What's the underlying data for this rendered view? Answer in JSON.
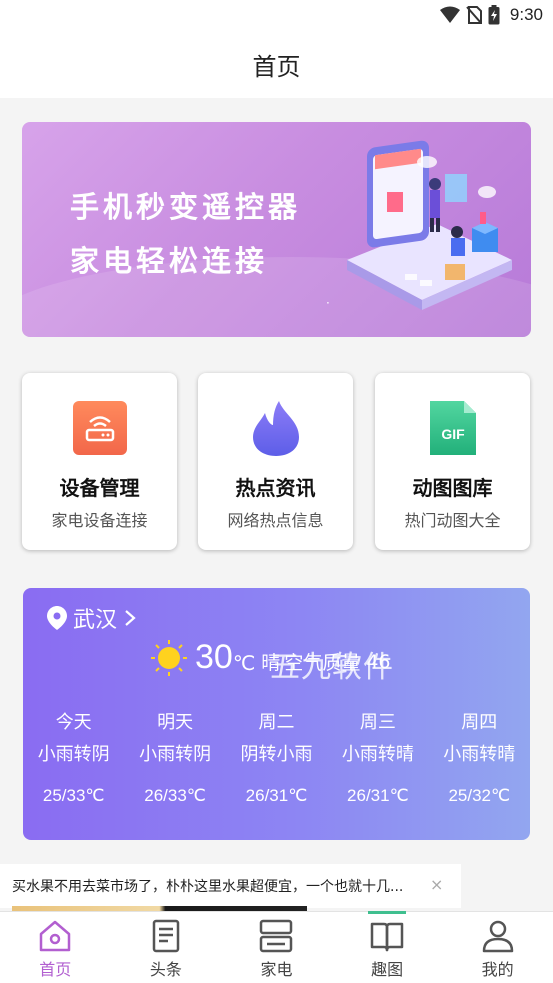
{
  "status_bar": {
    "time": "9:30"
  },
  "header": {
    "title": "首页"
  },
  "banner": {
    "line1": "手机秒变遥控器",
    "line2": "家电轻松连接"
  },
  "cards": [
    {
      "name": "设备管理",
      "sub": "家电设备连接",
      "icon": "router-icon"
    },
    {
      "name": "热点资讯",
      "sub": "网络热点信息",
      "icon": "flame-icon"
    },
    {
      "name": "动图图库",
      "sub": "热门动图大全",
      "icon": "gif-file-icon",
      "badge": "GIF"
    }
  ],
  "weather": {
    "city": "武汉",
    "temp": "30",
    "unit": "℃",
    "condition": "晴",
    "aqi_label": "空气质量",
    "aqi_value": "46",
    "watermark": "五九软件",
    "forecast": [
      {
        "day": "今天",
        "cond": "小雨转阴",
        "temp": "25/33℃"
      },
      {
        "day": "明天",
        "cond": "小雨转阴",
        "temp": "26/33℃"
      },
      {
        "day": "周二",
        "cond": "阴转小雨",
        "temp": "26/31℃"
      },
      {
        "day": "周三",
        "cond": "小雨转晴",
        "temp": "26/31℃"
      },
      {
        "day": "周四",
        "cond": "小雨转晴",
        "temp": "25/32℃"
      }
    ]
  },
  "ad": {
    "text": "买水果不用去菜市场了，朴朴这里水果超便宜，一个也就十几...",
    "close": "×"
  },
  "bottom_nav": [
    {
      "label": "首页",
      "icon": "home-icon",
      "active": true
    },
    {
      "label": "头条",
      "icon": "news-icon",
      "active": false
    },
    {
      "label": "家电",
      "icon": "appliance-icon",
      "active": false
    },
    {
      "label": "趣图",
      "icon": "book-icon",
      "active": false
    },
    {
      "label": "我的",
      "icon": "user-icon",
      "active": false
    }
  ],
  "colors": {
    "accent": "#b25fd0",
    "weather_start": "#8a6cf2",
    "weather_end": "#92a6f0",
    "banner": "#c88de0",
    "nav_indicator": "#3fbf8f"
  }
}
